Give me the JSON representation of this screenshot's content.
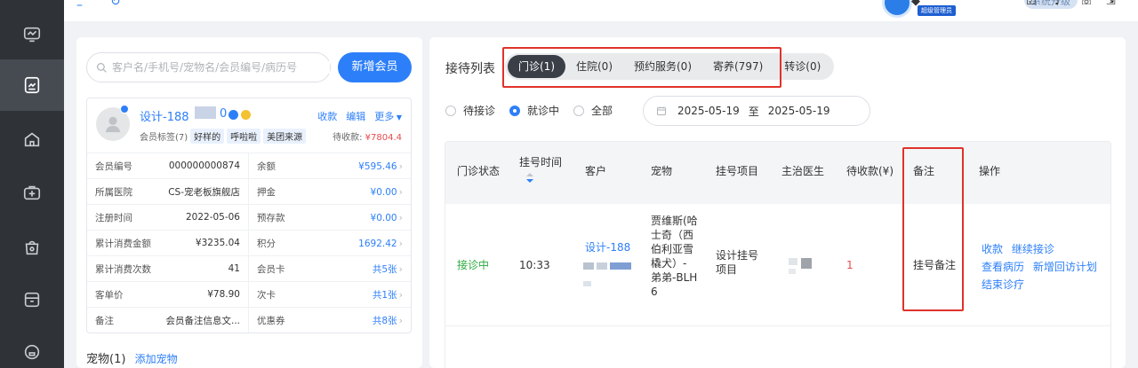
{
  "header": {
    "role_badge": "超级管理员",
    "upgrade_label": "系统升级"
  },
  "sidebar": {
    "items": [
      {
        "icon": "monitor-icon"
      },
      {
        "icon": "clipboard-icon",
        "active": true
      },
      {
        "icon": "home-icon"
      },
      {
        "icon": "medical-kit-icon"
      },
      {
        "icon": "bag-icon"
      },
      {
        "icon": "archive-box-icon"
      },
      {
        "icon": "support-icon"
      }
    ]
  },
  "member_panel": {
    "search_placeholder": "客户名/手机号/宠物名/会员编号/病历号",
    "add_member_label": "新增会员",
    "member": {
      "name": "设计-188",
      "name_suffix": "0",
      "actions": [
        "收款",
        "编辑",
        "更多"
      ],
      "tags_label": "会员标签(7)",
      "tags": [
        "好样的",
        "呼啦啦",
        "美团来源"
      ],
      "due_label": "待收款:",
      "due_value": "¥7804.4"
    },
    "info_rows": [
      [
        {
          "k": "会员编号",
          "v": "000000000874"
        },
        {
          "k": "余额",
          "v": "¥595.46",
          "blue": true
        }
      ],
      [
        {
          "k": "所属医院",
          "v": "CS-宠老板旗舰店"
        },
        {
          "k": "押金",
          "v": "¥0.00",
          "blue": true
        }
      ],
      [
        {
          "k": "注册时间",
          "v": "2022-05-06"
        },
        {
          "k": "预存款",
          "v": "¥0.00",
          "blue": true
        }
      ],
      [
        {
          "k": "累计消费金额",
          "v": "¥3235.04"
        },
        {
          "k": "积分",
          "v": "1692.42",
          "blue": true
        }
      ],
      [
        {
          "k": "累计消费次数",
          "v": "41"
        },
        {
          "k": "会员卡",
          "v": "共5张",
          "blue": true
        }
      ],
      [
        {
          "k": "客单价",
          "v": "¥78.90"
        },
        {
          "k": "次卡",
          "v": "共1张",
          "blue": true
        }
      ],
      [
        {
          "k": "备注",
          "v": "会员备注信息文..."
        },
        {
          "k": "优惠券",
          "v": "共8张",
          "blue": true
        }
      ]
    ],
    "pets_label": "宠物(1)",
    "add_pet_label": "添加宠物"
  },
  "reception": {
    "title": "接待列表",
    "tabs": [
      {
        "label": "门诊(1)",
        "active": true
      },
      {
        "label": "住院(0)"
      },
      {
        "label": "预约服务(0)"
      },
      {
        "label": "寄养(797)"
      },
      {
        "label": "转诊(0)"
      }
    ],
    "filters": [
      {
        "label": "待接诊",
        "checked": false
      },
      {
        "label": "就诊中",
        "checked": true
      },
      {
        "label": "全部",
        "checked": false
      }
    ],
    "date_from": "2025-05-19",
    "date_sep": "至",
    "date_to": "2025-05-19",
    "columns": [
      "门诊状态",
      "挂号时间",
      "客户",
      "宠物",
      "挂号项目",
      "主治医生",
      "待收款(¥)",
      "备注",
      "操作"
    ],
    "row": {
      "status": "接诊中",
      "time": "10:33",
      "customer": "设计-188",
      "pet_lines": [
        "贾维斯(哈",
        "士奇（西",
        "伯利亚雪",
        "橇犬）-",
        "弟弟-BLH",
        "6"
      ],
      "item_lines": [
        "设计挂号",
        "项目"
      ],
      "due": "1",
      "remark": "挂号备注",
      "ops": [
        [
          "收款",
          "继续接诊"
        ],
        [
          "查看病历",
          "新增回访计划"
        ],
        [
          "结束诊疗"
        ]
      ]
    }
  },
  "colors": {
    "primary": "#2d7ff9",
    "sidebar_bg": "#2f3237",
    "active_tab": "#3a3f47",
    "highlight_box": "#e0322b",
    "status_green": "#2eaa3f",
    "amount_red": "#e64b4b"
  }
}
